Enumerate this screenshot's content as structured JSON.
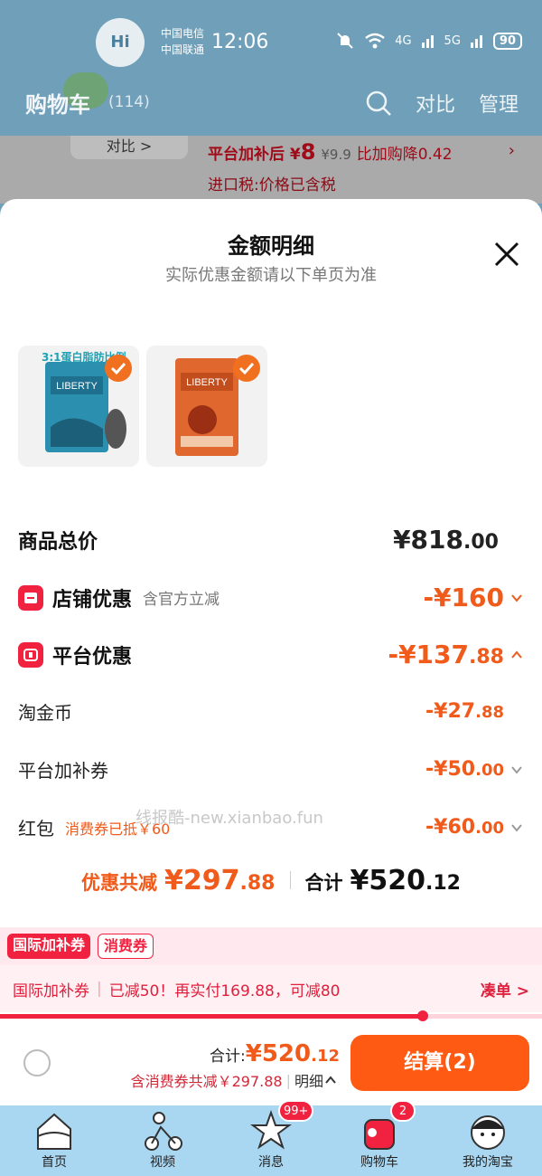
{
  "status_bar": {
    "carrier_1": "中国电信",
    "carrier_2": "中国联通",
    "time": "12:06",
    "network_1": "4G",
    "network_2": "5G",
    "battery": "90"
  },
  "background_page": {
    "title": "购物车",
    "count": "(114)",
    "compare": "对比",
    "manage": "管理",
    "compare_pill": "对比 >",
    "subsidy_prefix": "平台加补后 ¥",
    "subsidy_price": "8",
    "subsidy_original": "¥9.9",
    "subsidy_drop": "比加购降0.42",
    "tax_note": "进口税:价格已含税"
  },
  "sheet": {
    "title": "金额明细",
    "subtitle": "实际优惠金额请以下单页为准",
    "product_caption": "3:1蛋白脂肪比例",
    "products": [
      {
        "name": "LIBERTY",
        "color": "#2b8fb0"
      },
      {
        "name": "LIBERTY",
        "color": "#e0672e"
      }
    ],
    "rows": {
      "subtotal": {
        "label": "商品总价",
        "int": "¥818",
        "dec": ".00"
      },
      "store": {
        "label": "店铺优惠",
        "hint": "含官方立减",
        "int": "-¥160",
        "dec": ""
      },
      "platform": {
        "label": "平台优惠",
        "int": "-¥137",
        "dec": ".88"
      },
      "coins": {
        "label": "淘金币",
        "int": "-¥27",
        "dec": ".88"
      },
      "platform_coupon": {
        "label": "平台加补券",
        "int": "-¥50",
        "dec": ".00"
      },
      "red_packet": {
        "label": "红包",
        "tag": "消费券已抵￥60",
        "int": "-¥60",
        "dec": ".00"
      }
    },
    "watermark": "线报酷-new.xianbao.fun",
    "summary": {
      "saved_label": "优惠共减",
      "saved_int": "¥297",
      "saved_dec": ".88",
      "total_label": "合计",
      "total_int": "¥520",
      "total_dec": ".12"
    }
  },
  "coupon": {
    "tab_active": "国际加补券",
    "tab_inactive": "消费券",
    "bar_label": "国际加补券",
    "bar_text": "已减50！再实付169.88，可减80",
    "cta": "凑单 >",
    "progress": 0.78
  },
  "checkout": {
    "total_label": "合计:",
    "total_int": "¥520",
    "total_dec": ".12",
    "saved_text": "含消费券共减￥297.88",
    "detail": "明细",
    "pay_button": "结算(2)"
  },
  "nav": [
    {
      "label": "首页",
      "icon": "home-icon"
    },
    {
      "label": "视频",
      "icon": "video-icon"
    },
    {
      "label": "消息",
      "icon": "message-icon",
      "badge": "99+"
    },
    {
      "label": "购物车",
      "icon": "cart-icon",
      "badge": "2"
    },
    {
      "label": "我的淘宝",
      "icon": "profile-icon"
    }
  ],
  "colors": {
    "accent_orange": "#ff5a13",
    "discount_orange": "#f05a1a",
    "brand_red": "#f0223f",
    "nav_bg": "#a9d7f2"
  }
}
